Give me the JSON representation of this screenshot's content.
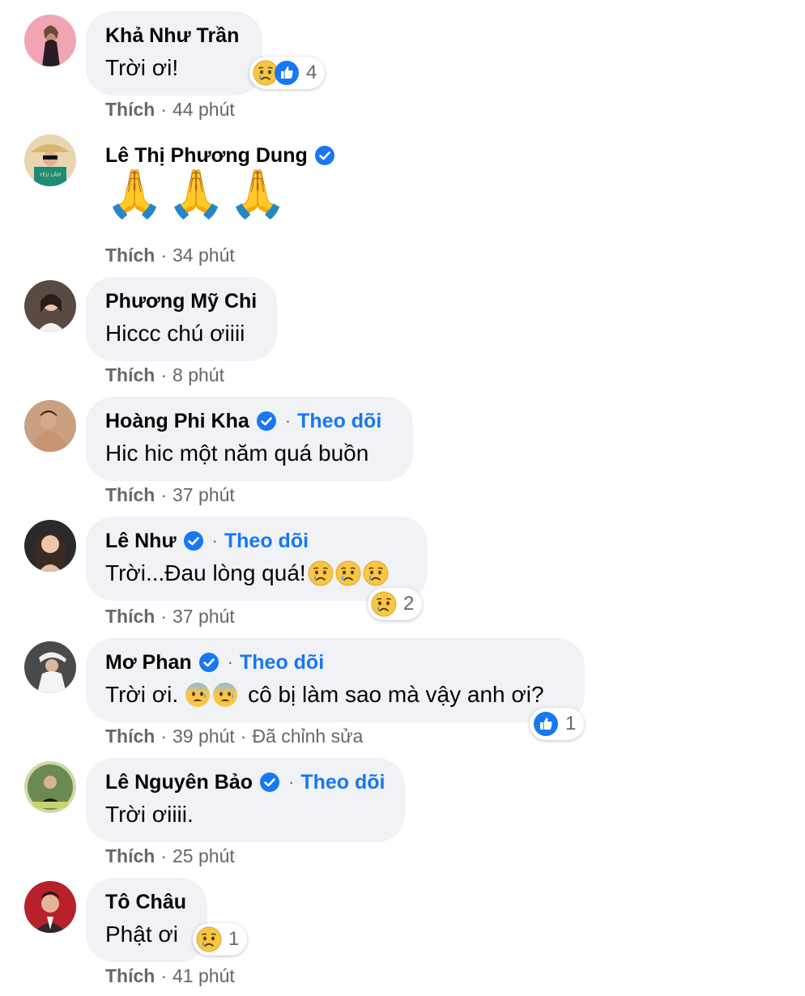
{
  "comments": [
    {
      "name": "Khả Như Trần",
      "verified": false,
      "text": "Trời ơi!",
      "like": "Thích",
      "time": "44 phút",
      "reacts": "4"
    },
    {
      "name": "Lê Thị Phương Dung",
      "verified": true,
      "text": "🙏🙏🙏",
      "like": "Thích",
      "time": "34 phút"
    },
    {
      "name": "Phương Mỹ Chi",
      "verified": false,
      "text": "Hiccc chú ơiiii",
      "like": "Thích",
      "time": "8 phút"
    },
    {
      "name": "Hoàng Phi Kha",
      "verified": true,
      "follow": "Theo dõi",
      "text": "Hic hic một năm quá buồn",
      "like": "Thích",
      "time": "37 phút"
    },
    {
      "name": "Lê Như",
      "verified": true,
      "follow": "Theo dõi",
      "text": "Trời...Đau lòng quá!",
      "like": "Thích",
      "time": "37 phút",
      "reacts": "2"
    },
    {
      "name": "Mơ Phan",
      "verified": true,
      "follow": "Theo dõi",
      "text_a": "Trời ơi.",
      "text_b": "cô bị làm sao mà vậy anh ơi?",
      "like": "Thích",
      "time": "39 phút",
      "edited": "Đã chỉnh sửa",
      "reacts": "1"
    },
    {
      "name": "Lê Nguyên Bảo",
      "verified": true,
      "follow": "Theo dõi",
      "text": "Trời ơiiii.",
      "like": "Thích",
      "time": "25 phút"
    },
    {
      "name": "Tô Châu",
      "verified": false,
      "text": "Phật ơi",
      "like": "Thích",
      "time": "41 phút",
      "reacts": "1"
    }
  ],
  "colors": {
    "bubble": "#f0f2f5",
    "link": "#1877f2",
    "meta": "#65676b",
    "text": "#050505"
  },
  "icons": [
    "verified-badge-icon",
    "sad-reaction-icon",
    "like-reaction-icon",
    "anxious-face-icon"
  ]
}
